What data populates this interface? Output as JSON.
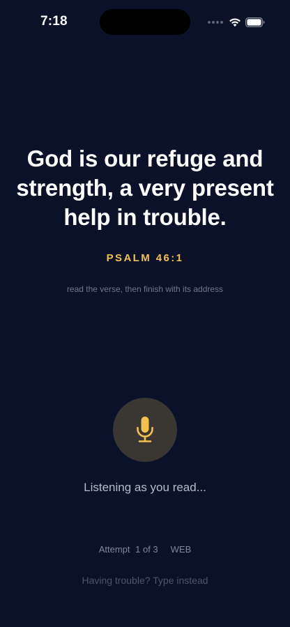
{
  "status_bar": {
    "time": "7:18",
    "icons": [
      "cellular-signal-icon",
      "wifi-icon",
      "battery-icon"
    ]
  },
  "verse": {
    "text": "God is our refuge and strength, a very present help in trouble.",
    "address": "PSALM 46:1"
  },
  "instruction": "read the verse, then finish with its address",
  "mic": {
    "icon": "microphone-icon",
    "status": "Listening as you read..."
  },
  "attempt": {
    "label": "Attempt",
    "count": "1 of 3",
    "translation": "WEB"
  },
  "fallback_link": "Having trouble? Type instead",
  "colors": {
    "background": "#0a1128",
    "accent": "#f2c14e",
    "mic_button_bg": "#3a3733"
  }
}
